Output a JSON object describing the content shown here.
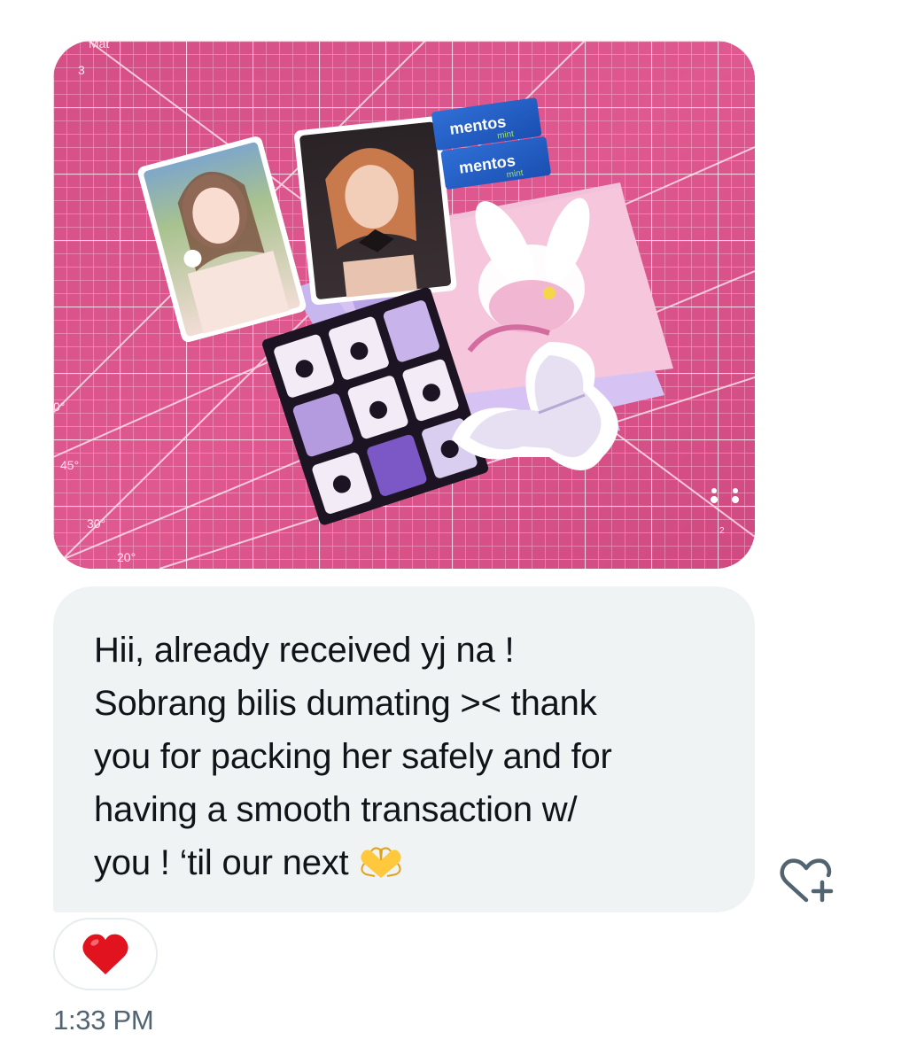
{
  "message": {
    "attachment": {
      "kind": "photo",
      "mat_labels": [
        "Mat",
        "3",
        "0°",
        "45°",
        "30°",
        "20°",
        "2"
      ],
      "product_labels": [
        "mentos",
        "mint",
        "mentos",
        "mint"
      ]
    },
    "text": "Hii, already received yj na !\nSobrang bilis dumating  >< thank\nyou for packing her safely and for\nhaving a smooth transaction w/\nyou ! ‘til our next",
    "text_emoji": "heart-hands",
    "reaction": {
      "emoji": "heart",
      "color": "#e0131f"
    },
    "add_reaction_icon": "heart-plus-icon",
    "timestamp": "1:33 PM"
  },
  "colors": {
    "bubble_bg": "#eff3f4",
    "text": "#0f1419",
    "muted": "#536471",
    "mat_pink": "#d9447e"
  }
}
